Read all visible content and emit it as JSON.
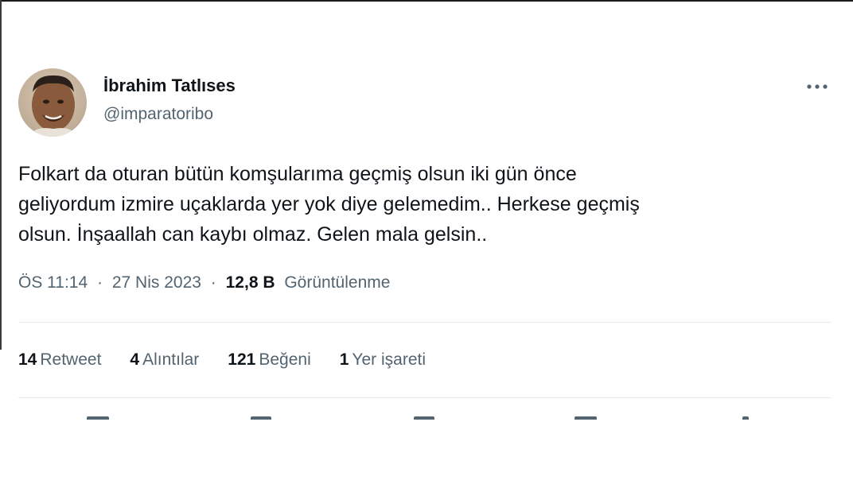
{
  "author": {
    "display_name": "İbrahim Tatlıses",
    "handle": "@imparatoribo"
  },
  "tweet": {
    "lines": [
      "Folkart da oturan bütün komşularıma geçmiş olsun iki gün önce",
      "geliyordum izmire uçaklarda yer yok diye gelemedim.. Herkese geçmiş",
      "olsun. İnşaallah can kaybı olmaz. Gelen mala gelsin.."
    ]
  },
  "meta": {
    "time": "ÖS 11:14",
    "separator": "·",
    "date": "27 Nis 2023",
    "views_count": "12,8 B",
    "views_label": "Görüntülenme"
  },
  "stats": {
    "retweets": {
      "count": "14",
      "label": "Retweet"
    },
    "quotes": {
      "count": "4",
      "label": "Alıntılar"
    },
    "likes": {
      "count": "121",
      "label": "Beğeni"
    },
    "bookmarks": {
      "count": "1",
      "label": "Yer işareti"
    }
  },
  "icons": {
    "more": "more-horizontal-icon",
    "reply": "reply-icon",
    "retweet": "retweet-icon",
    "like": "heart-icon",
    "bookmark": "bookmark-icon",
    "share": "share-icon"
  },
  "colors": {
    "text_primary": "#0f1419",
    "text_secondary": "#536471",
    "divider": "#e6ecf0"
  }
}
